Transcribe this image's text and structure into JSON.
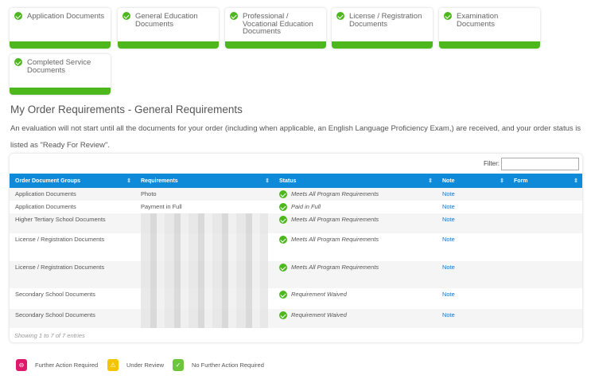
{
  "cards": [
    {
      "label": "Application Documents"
    },
    {
      "label": "General Education Documents"
    },
    {
      "label": "Professional / Vocational Education Documents"
    },
    {
      "label": "License / Registration Documents"
    },
    {
      "label": "Examination Documents"
    },
    {
      "label": "Completed Service Documents"
    }
  ],
  "section": {
    "title": "My Order Requirements - General Requirements",
    "intro": "An evaluation will not start until all the documents for your order (including when applicable, an English Language Proficiency Exam,) are received, and your order status is listed as \"Ready For Review\"."
  },
  "table": {
    "filter_label": "Filter:",
    "filter_value": "",
    "headers": [
      "Order Document Groups",
      "Requirements",
      "Status",
      "Note",
      "Form"
    ],
    "rows": [
      {
        "group": "Application Documents",
        "req": "Photo",
        "status": "Meets All Program Requirements",
        "note": "Note"
      },
      {
        "group": "Application Documents",
        "req": "Payment in Full",
        "status": "Paid in Full",
        "note": "Note"
      },
      {
        "group": "Higher Tertiary School Documents",
        "req": "",
        "status": "Meets All Program Requirements",
        "note": "Note"
      },
      {
        "group": "License / Registration Documents",
        "req": "",
        "status": "Meets All Program Requirements",
        "note": "Note"
      },
      {
        "group": "License / Registration Documents",
        "req": "",
        "status": "Meets All Program Requirements",
        "note": "Note"
      },
      {
        "group": "Secondary School Documents",
        "req": "",
        "status": "Requirement Waived",
        "note": "Note"
      },
      {
        "group": "Secondary School Documents",
        "req": "",
        "status": "Requirement Waived",
        "note": "Note"
      }
    ],
    "footer": "Showing 1 to 7 of 7 entries"
  },
  "legend": [
    {
      "label": "Further Action Required",
      "color": "#e0186c"
    },
    {
      "label": "Under Review",
      "color": "#f5c400"
    },
    {
      "label": "No Further Action Required",
      "color": "#6cc63a"
    }
  ]
}
